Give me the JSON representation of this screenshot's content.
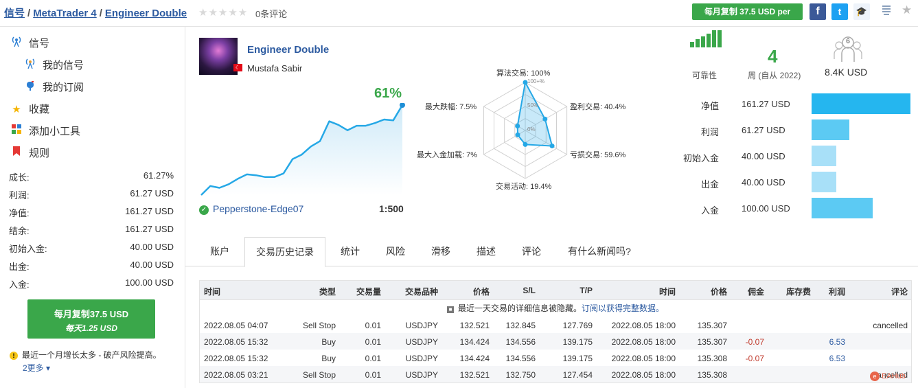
{
  "breadcrumb": {
    "part1": "信号",
    "sep": "/",
    "part2": "MetaTrader 4",
    "part3": "Engineer Double"
  },
  "rating": {
    "stars": "★★★★★",
    "reviews": "0条评论"
  },
  "header": {
    "copy_button": "每月复制 37.5 USD per",
    "facebook": "f",
    "twitter": "t",
    "grad": "🎓"
  },
  "sidebar": {
    "nav": [
      {
        "label": "信号",
        "icon": "antenna-icon"
      },
      {
        "label": "我的信号",
        "icon": "signal-icon"
      },
      {
        "label": "我的订阅",
        "icon": "mailbox-icon"
      },
      {
        "label": "收藏",
        "icon": "star-icon"
      },
      {
        "label": "添加小工具",
        "icon": "widget-icon"
      },
      {
        "label": "规则",
        "icon": "bookmark-icon"
      }
    ],
    "stats": [
      {
        "label": "成长:",
        "value": "61.27%"
      },
      {
        "label": "利润:",
        "value": "61.27 USD"
      },
      {
        "label": "净值:",
        "value": "161.27 USD"
      },
      {
        "label": "结余:",
        "value": "161.27 USD"
      },
      {
        "label": "初始入金:",
        "value": "40.00 USD"
      },
      {
        "label": "出金:",
        "value": "40.00 USD"
      },
      {
        "label": "入金:",
        "value": "100.00 USD"
      }
    ],
    "button_line1": "每月复制37.5 USD",
    "button_line2": "每天1.25 USD",
    "warning": "最近一个月增长太多 - 破产风险提高。",
    "more": "2更多"
  },
  "signal": {
    "name": "Engineer Double",
    "author": "Mustafa Sabir",
    "flag": "☾",
    "growth": "61%",
    "broker": "Pepperstone-Edge07",
    "leverage": "1:500"
  },
  "growth_chart": {
    "type": "line",
    "points": [
      0.0,
      0.1,
      0.08,
      0.12,
      0.18,
      0.23,
      0.22,
      0.2,
      0.2,
      0.24,
      0.4,
      0.45,
      0.54,
      0.6,
      0.82,
      0.78,
      0.72,
      0.77,
      0.77,
      0.8,
      0.84,
      0.83,
      1.0
    ]
  },
  "radar": {
    "type": "radar",
    "axes": [
      {
        "label": "算法交易: 100%",
        "value": 1.0
      },
      {
        "label": "盈利交易: 40.4%",
        "value": 0.404
      },
      {
        "label": "亏损交易: 59.6%",
        "value": 0.596
      },
      {
        "label": "交易活动: 19.4%",
        "value": 0.194
      },
      {
        "label": "最大入金加载: 7%",
        "value": 0.07
      },
      {
        "label": "最大跌幅: 7.5%",
        "value": 0.075
      }
    ],
    "ticks": [
      "100+%",
      "50%",
      "0%"
    ]
  },
  "kpis": {
    "reliability": "可靠性",
    "weeks_value": "4",
    "weeks_label": "周 (自从 2022)",
    "subscribers_count": "6",
    "subscribers": "8.4K USD"
  },
  "bars": [
    {
      "label": "净值",
      "value": "161.27 USD",
      "amount": 161.27,
      "color": "#25b6ef"
    },
    {
      "label": "利润",
      "value": "61.27 USD",
      "amount": 61.27,
      "color": "#5ccaf3"
    },
    {
      "label": "初始入金",
      "value": "40.00 USD",
      "amount": 40.0,
      "color": "#a8e0f8"
    },
    {
      "label": "出金",
      "value": "40.00 USD",
      "amount": 40.0,
      "color": "#a8e0f8"
    },
    {
      "label": "入金",
      "value": "100.00 USD",
      "amount": 100.0,
      "color": "#5ccaf3"
    }
  ],
  "tabs": [
    "账户",
    "交易历史记录",
    "统计",
    "风险",
    "滑移",
    "描述",
    "评论",
    "有什么新闻吗?"
  ],
  "table": {
    "headers": [
      "时间",
      "类型",
      "交易量",
      "交易品种",
      "价格",
      "S/L",
      "T/P",
      "时间",
      "价格",
      "佣金",
      "库存费",
      "利润",
      "评论"
    ],
    "notice": "最近一天交易的详细信息被隐藏。",
    "notice_link": "订阅以获得完整数据。",
    "rows": [
      [
        "2022.08.05 04:07",
        "Sell Stop",
        "0.01",
        "USDJPY",
        "132.521",
        "132.845",
        "127.769",
        "2022.08.05 18:00",
        "135.307",
        "",
        "",
        "",
        "cancelled"
      ],
      [
        "2022.08.05 15:32",
        "Buy",
        "0.01",
        "USDJPY",
        "134.424",
        "134.556",
        "139.175",
        "2022.08.05 18:00",
        "135.307",
        "-0.07",
        "",
        "6.53",
        ""
      ],
      [
        "2022.08.05 15:32",
        "Buy",
        "0.01",
        "USDJPY",
        "134.424",
        "134.556",
        "139.175",
        "2022.08.05 18:00",
        "135.308",
        "-0.07",
        "",
        "6.53",
        ""
      ],
      [
        "2022.08.05 03:21",
        "Sell Stop",
        "0.01",
        "USDJPY",
        "132.521",
        "132.750",
        "127.454",
        "2022.08.05 18:00",
        "135.308",
        "",
        "",
        "",
        "cancelled"
      ]
    ]
  },
  "watermark": "EAHub"
}
